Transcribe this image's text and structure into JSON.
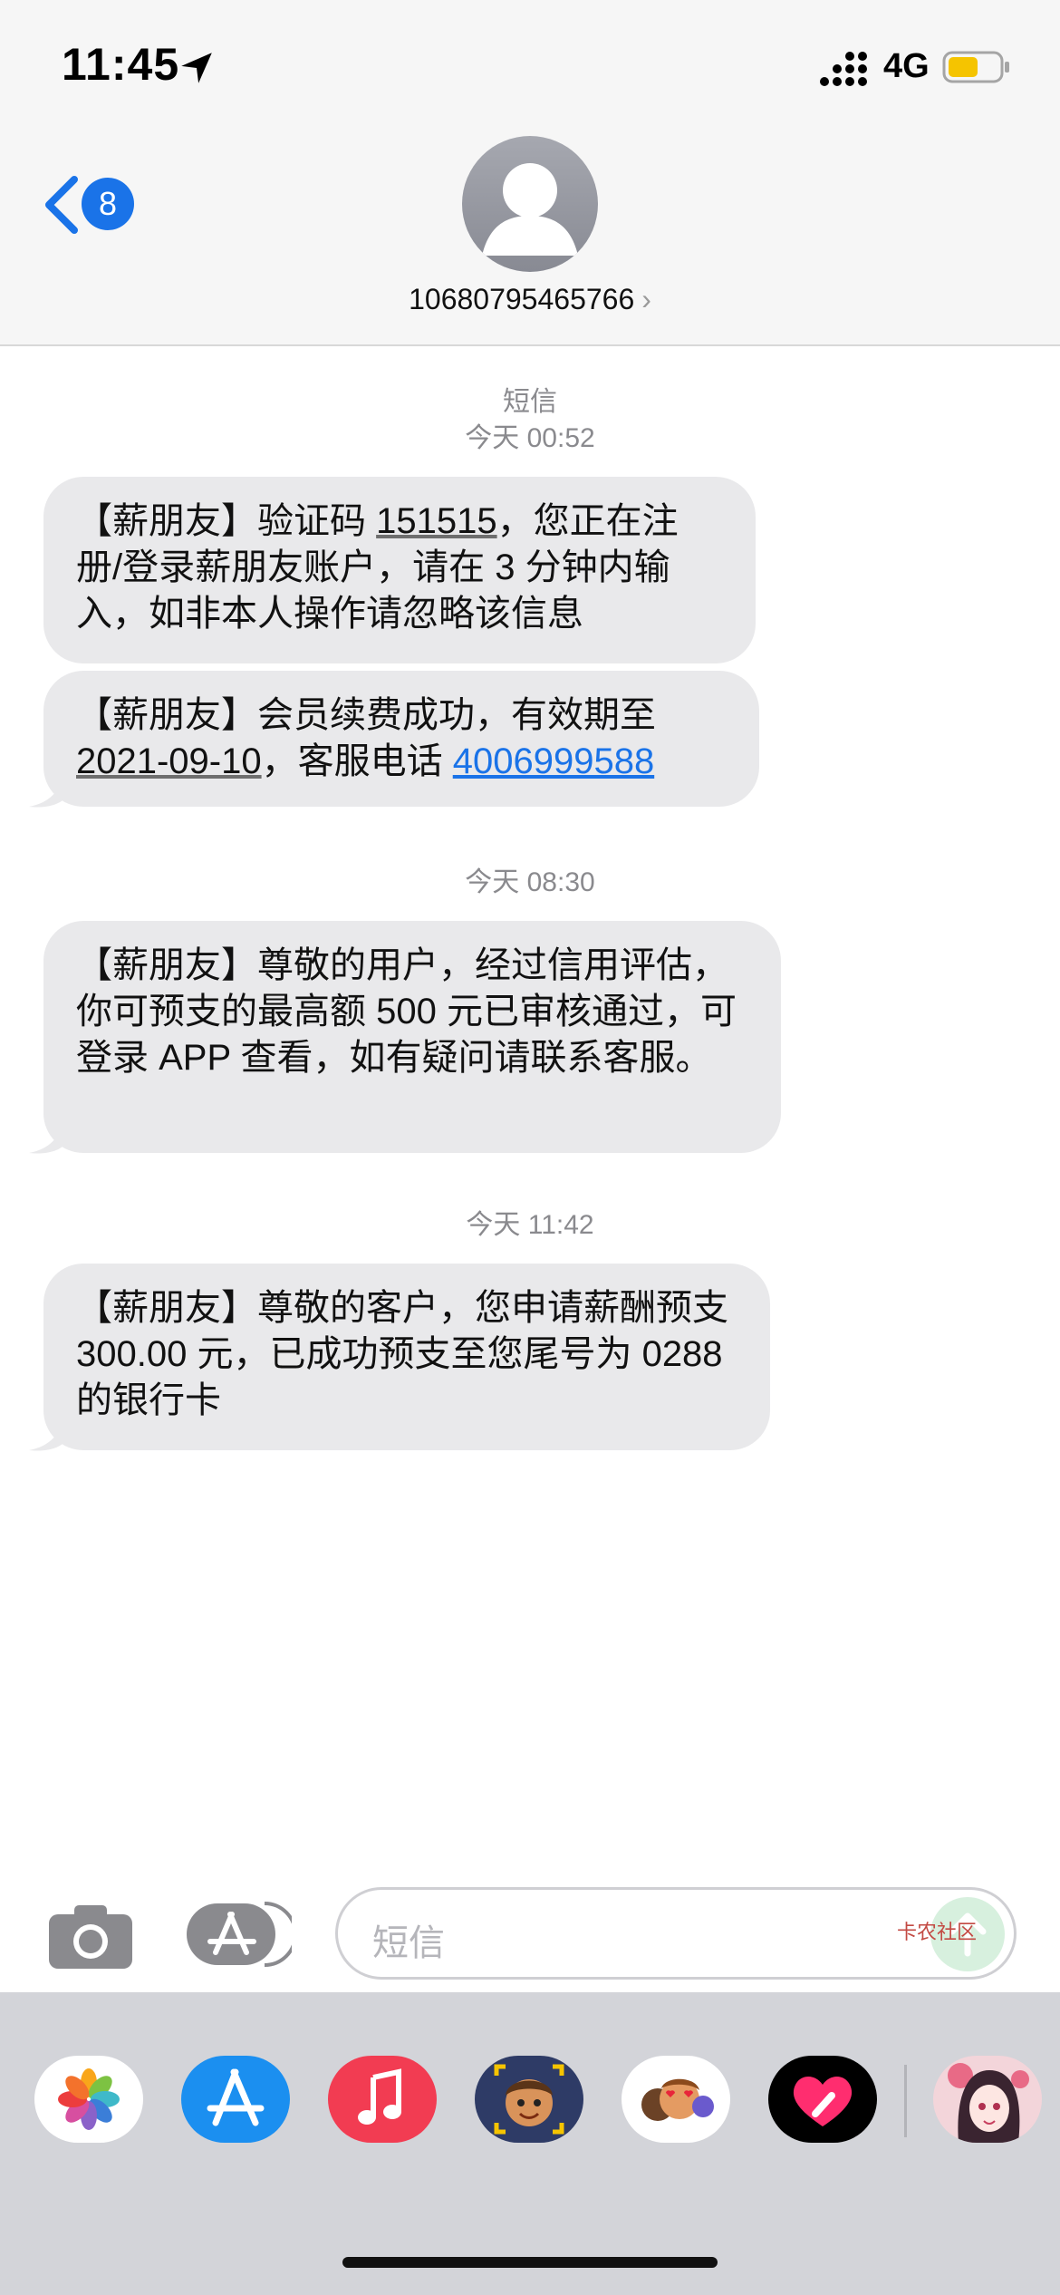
{
  "status_bar": {
    "time": "11:45",
    "network": "4G",
    "battery_color": "#f5c400"
  },
  "header": {
    "back_badge": "8",
    "contact_number": "10680795465766",
    "chevron": "›"
  },
  "conversation": {
    "service_label": "短信",
    "groups": [
      {
        "timestamp": "今天 00:52",
        "messages": [
          {
            "m1_a": "【薪朋友】验证码 ",
            "m1_code": "151515",
            "m1_b": "，您正在注册/登录薪朋友账户，请在 3 分钟内输入，如非本人操作请忽略该信息"
          },
          {
            "m2_a": "【薪朋友】会员续费成功，有效期至",
            "m2_date": "2021-09-10",
            "m2_b": "，客服电话 ",
            "m2_phone": "4006999588"
          }
        ]
      },
      {
        "timestamp": "今天 08:30",
        "text": "【薪朋友】尊敬的用户，经过信用评估，你可预支的最高额 500 元已审核通过，可登录 APP 查看，如有疑问请联系客服。"
      },
      {
        "timestamp": "今天 11:42",
        "text": "【薪朋友】尊敬的客户，您申请薪酬预支 300.00 元，已成功预支至您尾号为 0288 的银行卡"
      }
    ]
  },
  "input_bar": {
    "placeholder": "短信"
  },
  "app_drawer": {
    "apps": [
      "photos-icon",
      "app-store-icon",
      "music-icon",
      "memoji-icon",
      "animoji-icon",
      "digital-touch-icon",
      "sticker-icon"
    ]
  },
  "watermark": "卡农社区",
  "colors": {
    "link_blue": "#1a73e8",
    "bubble_gray": "#e9e9eb",
    "header_bg": "#f6f6f6"
  }
}
